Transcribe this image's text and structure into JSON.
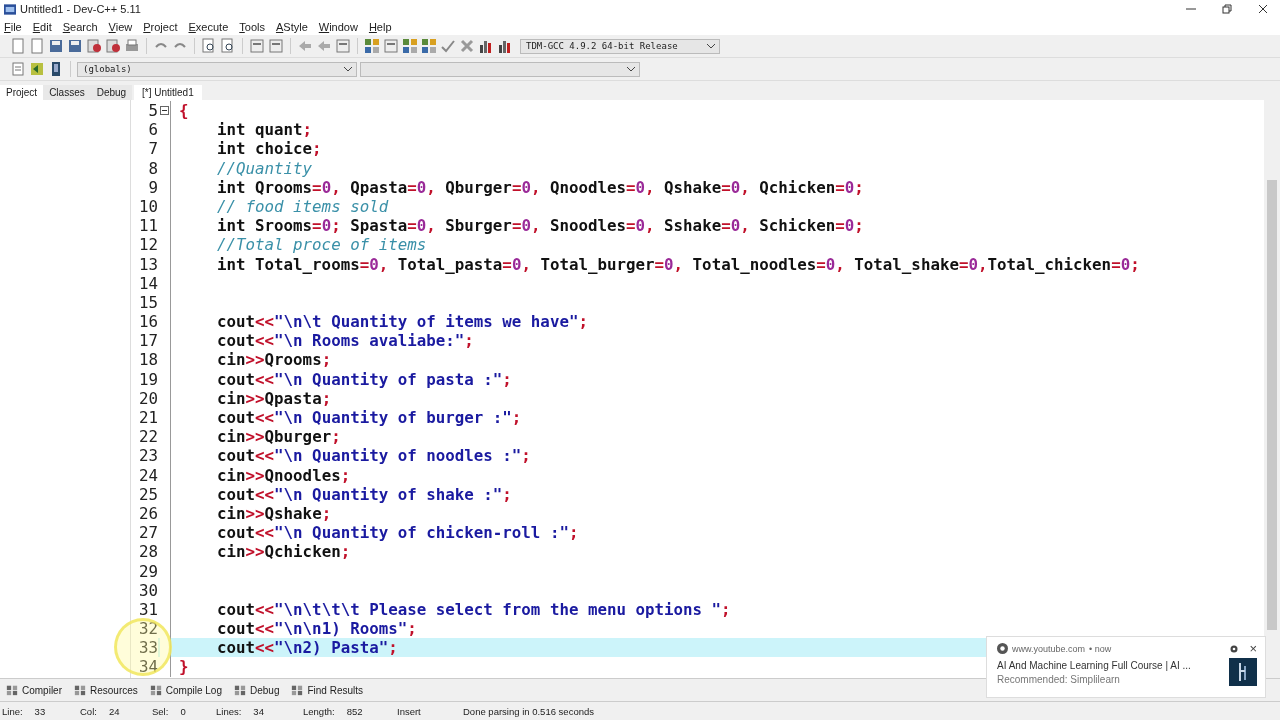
{
  "window": {
    "title": "Untitled1 - Dev-C++ 5.11"
  },
  "menu": [
    "File",
    "Edit",
    "Search",
    "View",
    "Project",
    "Execute",
    "Tools",
    "AStyle",
    "Window",
    "Help"
  ],
  "compiler_select": {
    "value": "TDM-GCC 4.9.2 64-bit Release"
  },
  "scope_select": {
    "value": "(globals)"
  },
  "side_tabs": [
    {
      "label": "Project",
      "selected": true
    },
    {
      "label": "Classes",
      "selected": false
    },
    {
      "label": "Debug",
      "selected": false
    }
  ],
  "editor_tabs": [
    {
      "label": "[*] Untitled1",
      "selected": true
    }
  ],
  "lines": [
    {
      "number": "5",
      "text": "{",
      "indent": false,
      "fold": true,
      "highlighted": false
    },
    {
      "number": "6",
      "text": "int quant;",
      "indent": true,
      "fold": false,
      "highlighted": false
    },
    {
      "number": "7",
      "text": "int choice;",
      "indent": true,
      "fold": false,
      "highlighted": false
    },
    {
      "number": "8",
      "text": "//Quantity",
      "indent": true,
      "fold": false,
      "highlighted": false
    },
    {
      "number": "9",
      "text": "int Qrooms=0, Qpasta=0, Qburger=0, Qnoodles=0, Qshake=0, Qchicken=0;",
      "indent": true,
      "fold": false,
      "highlighted": false
    },
    {
      "number": "10",
      "text": "// food items sold",
      "indent": true,
      "fold": false,
      "highlighted": false
    },
    {
      "number": "11",
      "text": "int Srooms=0; Spasta=0, Sburger=0, Snoodles=0, Sshake=0, Schicken=0;",
      "indent": true,
      "fold": false,
      "highlighted": false
    },
    {
      "number": "12",
      "text": "//Total proce of items",
      "indent": true,
      "fold": false,
      "highlighted": false
    },
    {
      "number": "13",
      "text": "int Total_rooms=0, Total_pasta=0, Total_burger=0, Total_noodles=0, Total_shake=0,Total_chicken=0;",
      "indent": true,
      "fold": false,
      "highlighted": false
    },
    {
      "number": "14",
      "fold": false,
      "highlighted": false
    },
    {
      "number": "15",
      "fold": false,
      "highlighted": false
    },
    {
      "number": "16",
      "text": "cout<<\"\\n\\t Quantity of items we have\";",
      "indent": true,
      "fold": false,
      "highlighted": false
    },
    {
      "number": "17",
      "text": "cout<<\"\\n Rooms avaliabe:\";",
      "indent": true,
      "fold": false,
      "highlighted": false
    },
    {
      "number": "18",
      "text": "cin>>Qrooms;",
      "indent": true,
      "fold": false,
      "highlighted": false
    },
    {
      "number": "19",
      "text": "cout<<\"\\n Quantity of pasta :\";",
      "indent": true,
      "fold": false,
      "highlighted": false
    },
    {
      "number": "20",
      "text": "cin>>Qpasta;",
      "indent": true,
      "fold": false,
      "highlighted": false
    },
    {
      "number": "21",
      "text": "cout<<\"\\n Quantity of burger :\";",
      "indent": true,
      "fold": false,
      "highlighted": false
    },
    {
      "number": "22",
      "text": "cin>>Qburger;",
      "indent": true,
      "fold": false,
      "highlighted": false
    },
    {
      "number": "23",
      "text": "cout<<\"\\n Quantity of noodles :\";",
      "indent": true,
      "fold": false,
      "highlighted": false
    },
    {
      "number": "24",
      "text": "cin>>Qnoodles;",
      "indent": true,
      "fold": false,
      "highlighted": false
    },
    {
      "number": "25",
      "text": "cout<<\"\\n Quantity of shake :\";",
      "indent": true,
      "fold": false,
      "highlighted": false
    },
    {
      "number": "26",
      "text": "cin>>Qshake;",
      "indent": true,
      "fold": false,
      "highlighted": false
    },
    {
      "number": "27",
      "text": "cout<<\"\\n Quantity of chicken-roll :\";",
      "indent": true,
      "fold": false,
      "highlighted": false
    },
    {
      "number": "28",
      "text": "cin>>Qchicken;",
      "indent": true,
      "fold": false,
      "highlighted": false
    },
    {
      "number": "29",
      "fold": false,
      "highlighted": false
    },
    {
      "number": "30",
      "fold": false,
      "highlighted": false
    },
    {
      "number": "31",
      "text": "cout<<\"\\n\\t\\t\\t Please select from the menu options \";",
      "indent": true,
      "fold": false,
      "highlighted": false
    },
    {
      "number": "32",
      "text": "cout<<\"\\n\\n1) Rooms\";",
      "indent": true,
      "fold": false,
      "highlighted": false
    },
    {
      "number": "33",
      "text": "cout<<\"\\n2) Pasta\";",
      "indent": true,
      "fold": false,
      "highlighted": true
    },
    {
      "number": "34",
      "text": "}",
      "indent": false,
      "fold": false,
      "highlighted": false
    }
  ],
  "bottom_tabs": [
    {
      "label": "Compiler"
    },
    {
      "label": "Resources"
    },
    {
      "label": "Compile Log"
    },
    {
      "label": "Debug"
    },
    {
      "label": "Find Results"
    }
  ],
  "status_bar": [
    {
      "label": "Line:",
      "value": "33"
    },
    {
      "label": "Col:",
      "value": "24"
    },
    {
      "label": "Sel:",
      "value": "0"
    },
    {
      "label": "Lines:",
      "value": "34"
    },
    {
      "label": "Length:",
      "value": "852"
    },
    {
      "value": "Insert"
    },
    {
      "value": "Done parsing in 0.516 seconds"
    }
  ],
  "notification": {
    "source": "www.youtube.com",
    "time": "• now",
    "title": "AI And Machine Learning Full Course | AI ...",
    "subtitle": "Recommended: Simplilearn",
    "close": "×"
  }
}
